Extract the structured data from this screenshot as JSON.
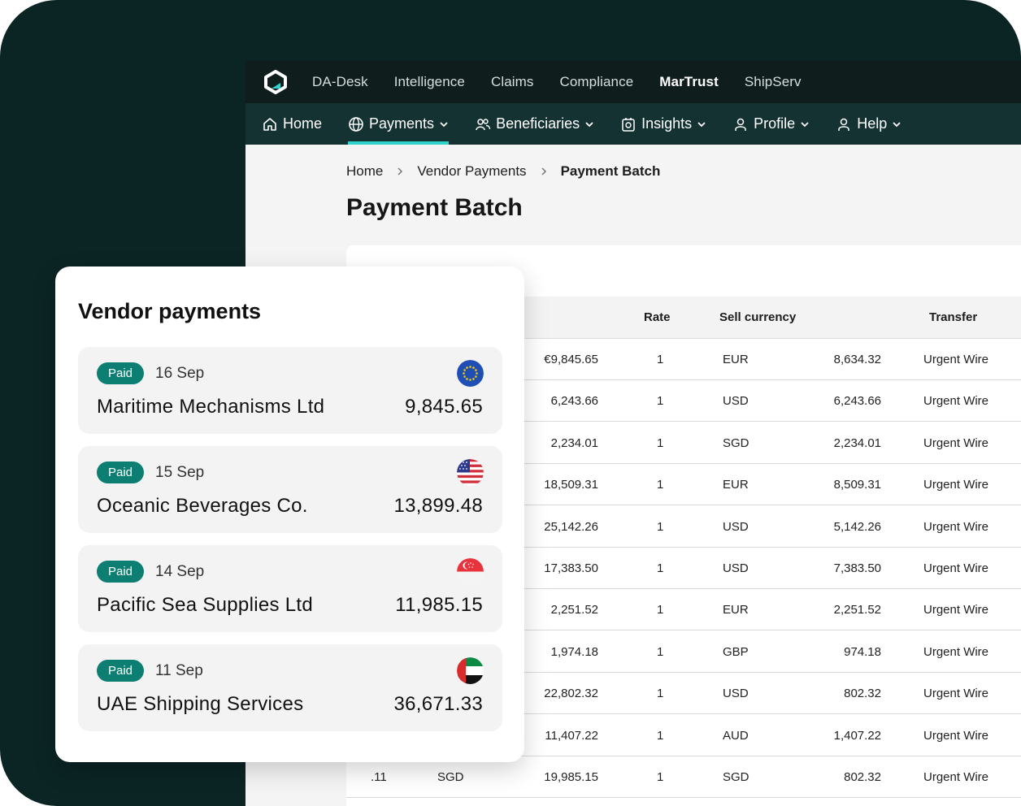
{
  "topnav": {
    "items": [
      "DA-Desk",
      "Intelligence",
      "Claims",
      "Compliance",
      "MarTrust",
      "ShipServ"
    ],
    "active": "MarTrust"
  },
  "subnav": {
    "home": "Home",
    "payments": "Payments",
    "beneficiaries": "Beneficiaries",
    "insights": "Insights",
    "profile": "Profile",
    "help": "Help"
  },
  "breadcrumb": {
    "home": "Home",
    "vendor_payments": "Vendor Payments",
    "current": "Payment Batch"
  },
  "page_title": "Payment Batch",
  "table": {
    "headers": {
      "rate": "Rate",
      "sell_currency": "Sell currency",
      "transfer": "Transfer"
    },
    "rows": [
      {
        "amount": "€9,845.65",
        "rate": "1",
        "currency": "EUR",
        "sell_amount": "8,634.32",
        "transfer": "Urgent Wire"
      },
      {
        "amount": "6,243.66",
        "rate": "1",
        "currency": "USD",
        "sell_amount": "6,243.66",
        "transfer": "Urgent Wire"
      },
      {
        "amount": "2,234.01",
        "rate": "1",
        "currency": "SGD",
        "sell_amount": "2,234.01",
        "transfer": "Urgent Wire"
      },
      {
        "amount": "18,509.31",
        "rate": "1",
        "currency": "EUR",
        "sell_amount": "8,509.31",
        "transfer": "Urgent Wire"
      },
      {
        "amount": "25,142.26",
        "rate": "1",
        "currency": "USD",
        "sell_amount": "5,142.26",
        "transfer": "Urgent Wire"
      },
      {
        "amount": "17,383.50",
        "rate": "1",
        "currency": "USD",
        "sell_amount": "7,383.50",
        "transfer": "Urgent Wire"
      },
      {
        "amount": "2,251.52",
        "rate": "1",
        "currency": "EUR",
        "sell_amount": "2,251.52",
        "transfer": "Urgent Wire"
      },
      {
        "amount": "1,974.18",
        "rate": "1",
        "currency": "GBP",
        "sell_amount": "974.18",
        "transfer": "Urgent Wire"
      },
      {
        "amount": "22,802.32",
        "rate": "1",
        "currency": "USD",
        "sell_amount": "802.32",
        "transfer": "Urgent Wire"
      },
      {
        "amount": "11,407.22",
        "rate": "1",
        "currency": "AUD",
        "sell_amount": "1,407.22",
        "transfer": "Urgent Wire"
      },
      {
        "lead": ".11",
        "lead_currency": "SGD",
        "amount": "19,985.15",
        "rate": "1",
        "currency": "SGD",
        "sell_amount": "802.32",
        "transfer": "Urgent Wire"
      }
    ]
  },
  "vendor_card": {
    "title": "Vendor payments",
    "items": [
      {
        "status": "Paid",
        "date": "16 Sep",
        "name": "Maritime Mechanisms Ltd",
        "amount": "9,845.65",
        "flag": "eu-flag-icon"
      },
      {
        "status": "Paid",
        "date": "15 Sep",
        "name": "Oceanic Beverages Co.",
        "amount": "13,899.48",
        "flag": "us-flag-icon"
      },
      {
        "status": "Paid",
        "date": "14 Sep",
        "name": "Pacific Sea Supplies Ltd",
        "amount": "11,985.15",
        "flag": "sg-flag-icon"
      },
      {
        "status": "Paid",
        "date": "11 Sep",
        "name": "UAE Shipping Services",
        "amount": "36,671.33",
        "flag": "ae-flag-icon"
      }
    ]
  },
  "colors": {
    "frame": "#0b2424",
    "topbar": "#0f1d1d",
    "subbar": "#143232",
    "accent": "#2fd3cc",
    "badge": "#0d7f72"
  }
}
